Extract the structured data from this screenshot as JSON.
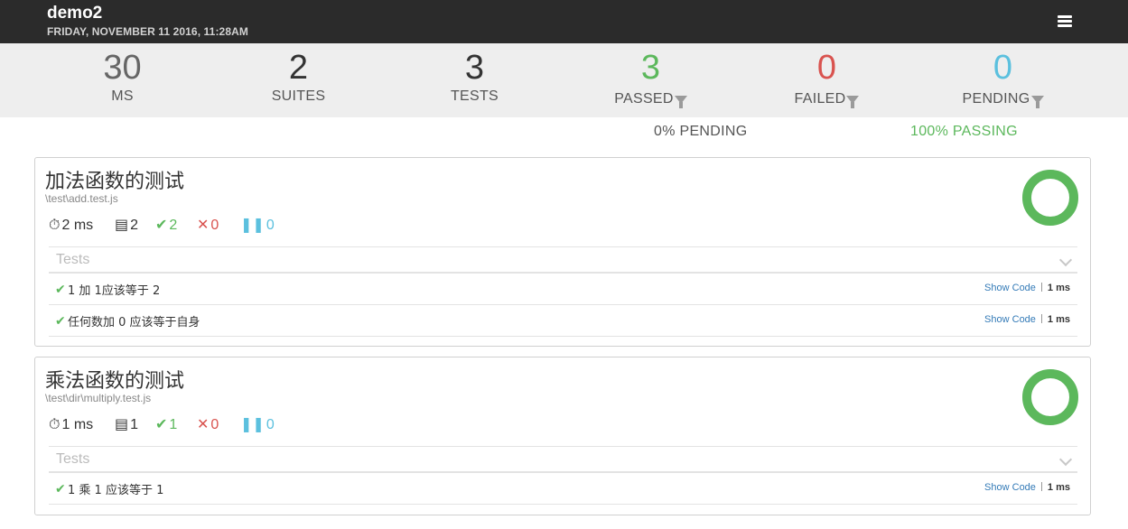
{
  "report": {
    "title": "demo2",
    "date": "FRIDAY, NOVEMBER 11 2016, 11:28AM"
  },
  "stats": {
    "duration": {
      "value": "30",
      "label": "MS"
    },
    "suites": {
      "value": "2",
      "label": "SUITES"
    },
    "tests": {
      "value": "3",
      "label": "TESTS"
    },
    "passed": {
      "value": "3",
      "label": "PASSED"
    },
    "failed": {
      "value": "0",
      "label": "FAILED"
    },
    "pending": {
      "value": "0",
      "label": "PENDING"
    },
    "pending_pct": "0% PENDING",
    "passing_pct": "100% PASSING"
  },
  "colors": {
    "passed": "#5cb85c",
    "failed": "#d9534f",
    "pending": "#5bc0de",
    "navbar": "#2b2b2b",
    "stats_bg": "#eeeeee"
  },
  "suites": [
    {
      "title": "加法函数的测试",
      "file": "\\test\\add.test.js",
      "duration": "2 ms",
      "total": "2",
      "passed": "2",
      "failed": "0",
      "pending": "0",
      "pass_fraction": 1.0,
      "tests_label": "Tests",
      "tests": [
        {
          "title": "1 加 1应该等于 2",
          "show_code": "Show Code",
          "duration": "1 ms"
        },
        {
          "title": "任何数加 0 应该等于自身",
          "show_code": "Show Code",
          "duration": "1 ms"
        }
      ]
    },
    {
      "title": "乘法函数的测试",
      "file": "\\test\\dir\\multiply.test.js",
      "duration": "1 ms",
      "total": "1",
      "passed": "1",
      "failed": "0",
      "pending": "0",
      "pass_fraction": 1.0,
      "tests_label": "Tests",
      "tests": [
        {
          "title": "1 乘 1 应该等于 1",
          "show_code": "Show Code",
          "duration": "1 ms"
        }
      ]
    }
  ],
  "icons": {
    "menu": "hamburger-menu-icon",
    "filter": "filter-icon",
    "duration": "stopwatch-icon",
    "total": "document-icon",
    "passed": "checkmark-icon",
    "failed": "x-icon",
    "pending": "pause-icon",
    "expand": "chevron-down-icon"
  }
}
